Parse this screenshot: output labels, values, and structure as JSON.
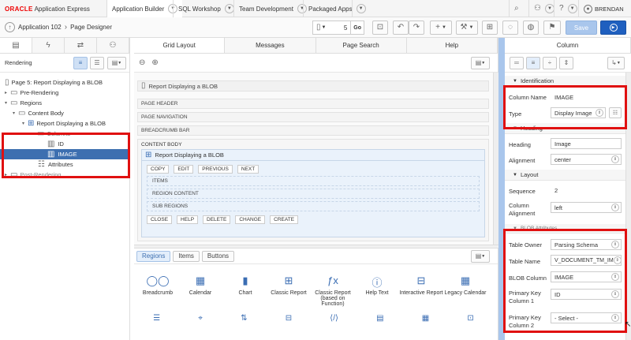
{
  "top": {
    "logo_oracle": "ORACLE",
    "logo_app": "Application Express",
    "tabs": [
      "Application Builder",
      "SQL Workshop",
      "Team Development",
      "Packaged Apps"
    ],
    "user": "BRENDAN"
  },
  "secbar": {
    "breadcrumb_app": "Application 102",
    "breadcrumb_page": "Page Designer",
    "page_number": "5",
    "go": "Go",
    "save": "Save"
  },
  "left": {
    "panel_title": "Rendering",
    "tree": [
      "Page 5: Report Displaying a BLOB",
      "Pre-Rendering",
      "Regions",
      "Content Body",
      "Report Displaying a BLOB",
      "Columns",
      "ID",
      "IMAGE",
      "Attributes",
      "Post-Rendering"
    ]
  },
  "center": {
    "tabs": [
      "Grid Layout",
      "Messages",
      "Page Search",
      "Help"
    ],
    "region_title": "Report Displaying a BLOB",
    "page_header": "PAGE HEADER",
    "page_navigation": "PAGE NAVIGATION",
    "breadcrumb_bar": "BREADCRUMB BAR",
    "content_body": "CONTENT BODY",
    "report_region": "Report Displaying a BLOB",
    "buttons_top": [
      "COPY",
      "EDIT",
      "PREVIOUS",
      "NEXT"
    ],
    "items": "ITEMS",
    "region_content": "REGION CONTENT",
    "sub_regions": "SUB REGIONS",
    "buttons_bottom": [
      "CLOSE",
      "HELP",
      "DELETE",
      "CHANGE",
      "CREATE"
    ],
    "gallery_tabs": [
      "Regions",
      "Items",
      "Buttons"
    ],
    "gallery": [
      {
        "label": "Breadcrumb",
        "icon": "breadcrumb-icon"
      },
      {
        "label": "Calendar",
        "icon": "calendar-icon"
      },
      {
        "label": "Chart",
        "icon": "chart-icon"
      },
      {
        "label": "Classic Report",
        "icon": "table-icon"
      },
      {
        "label": "Classic Report (based on Function)",
        "icon": "function-icon"
      },
      {
        "label": "Help Text",
        "icon": "help-icon"
      },
      {
        "label": "Interactive Report",
        "icon": "interactive-report-icon"
      },
      {
        "label": "Legacy Calendar",
        "icon": "legacy-calendar-icon"
      }
    ]
  },
  "right": {
    "panel_title": "Column",
    "identification": "Identification",
    "column_name_label": "Column Name",
    "column_name_value": "IMAGE",
    "type_label": "Type",
    "type_value": "Display Image",
    "heading_section": "Heading",
    "heading_label": "Heading",
    "heading_value": "Image",
    "alignment_label": "Alignment",
    "alignment_value": "center",
    "layout_section": "Layout",
    "sequence_label": "Sequence",
    "sequence_value": "2",
    "col_align_label1": "Column",
    "col_align_label2": "Alignment",
    "col_align_value": "left",
    "blob_section": "BLOB Attributes",
    "table_owner_label": "Table Owner",
    "table_owner_value": "Parsing Schema",
    "table_name_label": "Table Name",
    "table_name_value": "V_DOCUMENT_TM_IM",
    "blob_col_label": "BLOB Column",
    "blob_col_value": "IMAGE",
    "pk1_label1": "Primary Key",
    "pk1_label2": "Column 1",
    "pk1_value": "ID",
    "pk2_label1": "Primary Key",
    "pk2_label2": "Column 2",
    "pk2_value": "- Select -"
  },
  "colors": {
    "accent": "#3d6fb0",
    "highlight": "#e01010",
    "save_button": "#a9c6ec",
    "run_button": "#1f5fbf"
  }
}
